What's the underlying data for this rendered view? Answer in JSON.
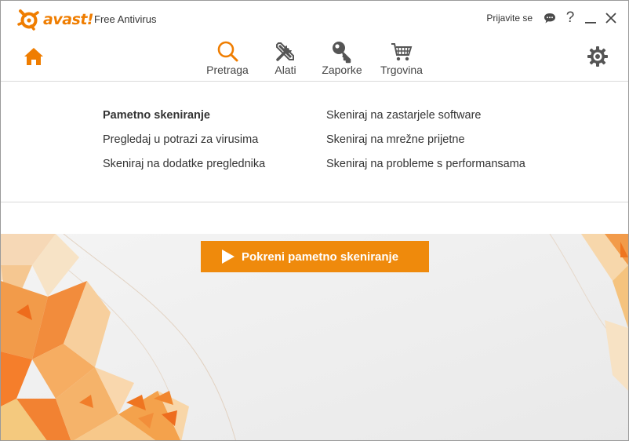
{
  "app": {
    "logo_text": "avast!",
    "name": "Free Antivirus"
  },
  "top_bar": {
    "signin_label": "Prijavite se",
    "chat_icon": "chat-bubble-icon",
    "help_label": "?",
    "minimize_icon": "minimize-icon",
    "close_icon": "close-icon"
  },
  "nav": {
    "home_icon": "home-icon",
    "settings_icon": "gear-icon",
    "items": [
      {
        "label": "Pretraga",
        "icon": "search-icon",
        "active": true
      },
      {
        "label": "Alati",
        "icon": "tools-icon",
        "active": false
      },
      {
        "label": "Zaporke",
        "icon": "key-icon",
        "active": false
      },
      {
        "label": "Trgovina",
        "icon": "cart-icon",
        "active": false
      }
    ]
  },
  "scan_options": {
    "left": [
      {
        "label": "Pametno skeniranje",
        "bold": true
      },
      {
        "label": "Pregledaj u potrazi za virusima",
        "bold": false
      },
      {
        "label": "Skeniraj na dodatke preglednika",
        "bold": false
      }
    ],
    "right": [
      {
        "label": "Skeniraj na zastarjele software",
        "bold": false
      },
      {
        "label": "Skeniraj na mrežne prijetne",
        "bold": false
      },
      {
        "label": "Skeniraj na probleme s performansama",
        "bold": false
      }
    ]
  },
  "scan_button": {
    "label": "Pokreni pametno skeniranje",
    "icon": "play-icon"
  },
  "colors": {
    "accent": "#ef7d00",
    "button": "#ef8a0c",
    "banner_bg": "#f0f0f0"
  }
}
